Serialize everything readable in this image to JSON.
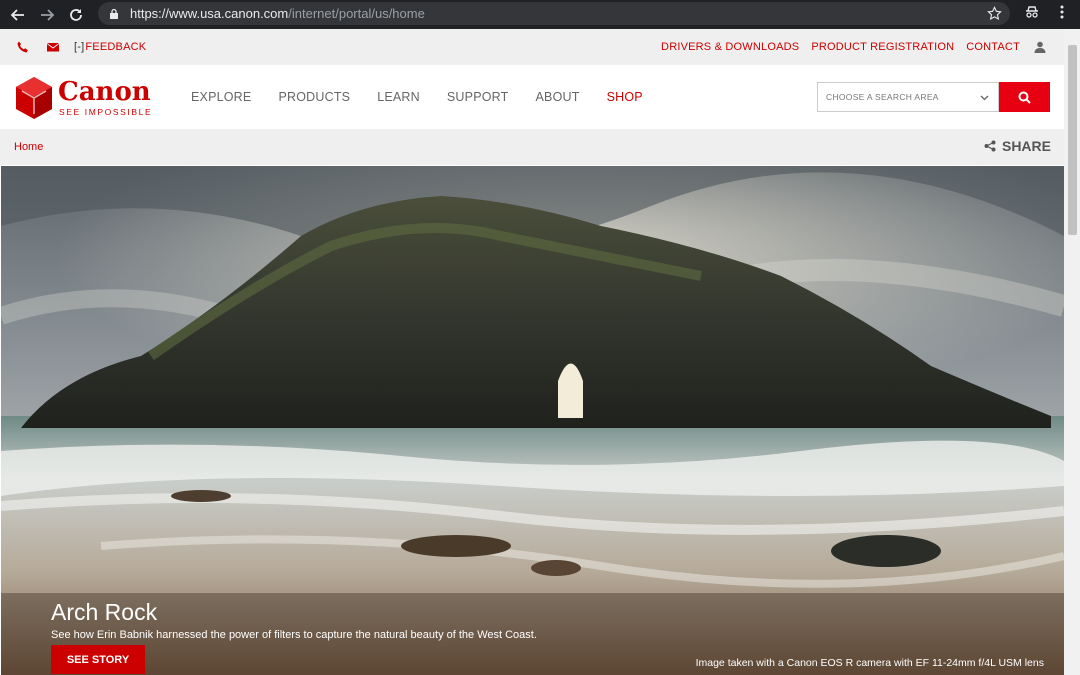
{
  "browser": {
    "url_host": "https://www.usa.canon.com",
    "url_path": "/internet/portal/us/home",
    "icons": [
      "back-arrow-icon",
      "forward-arrow-icon",
      "reload-icon",
      "lock-icon",
      "bookmark-star-icon",
      "incognito-icon",
      "kebab-menu-icon"
    ]
  },
  "utility": {
    "feedback_icon": "[-]",
    "feedback_label": "FEEDBACK",
    "links": [
      "DRIVERS & DOWNLOADS",
      "PRODUCT REGISTRATION",
      "CONTACT"
    ]
  },
  "header": {
    "logo_name": "Canon",
    "logo_tagline": "SEE IMPOSSIBLE",
    "nav": [
      "EXPLORE",
      "PRODUCTS",
      "LEARN",
      "SUPPORT",
      "ABOUT",
      "SHOP"
    ],
    "search_placeholder": "CHOOSE A SEARCH AREA"
  },
  "breadcrumb": {
    "home": "Home",
    "share_label": "SHARE"
  },
  "hero": {
    "title": "Arch Rock",
    "description": "See how Erin Babnik harnessed the power of filters to capture the natural beauty of the West Coast.",
    "button_label": "SEE STORY",
    "credit": "Image taken with a Canon EOS R camera with EF 11-24mm f/4L USM lens"
  },
  "colors": {
    "brand_red": "#cc0000",
    "button_red": "#e60012",
    "chrome_dark": "#202124"
  }
}
